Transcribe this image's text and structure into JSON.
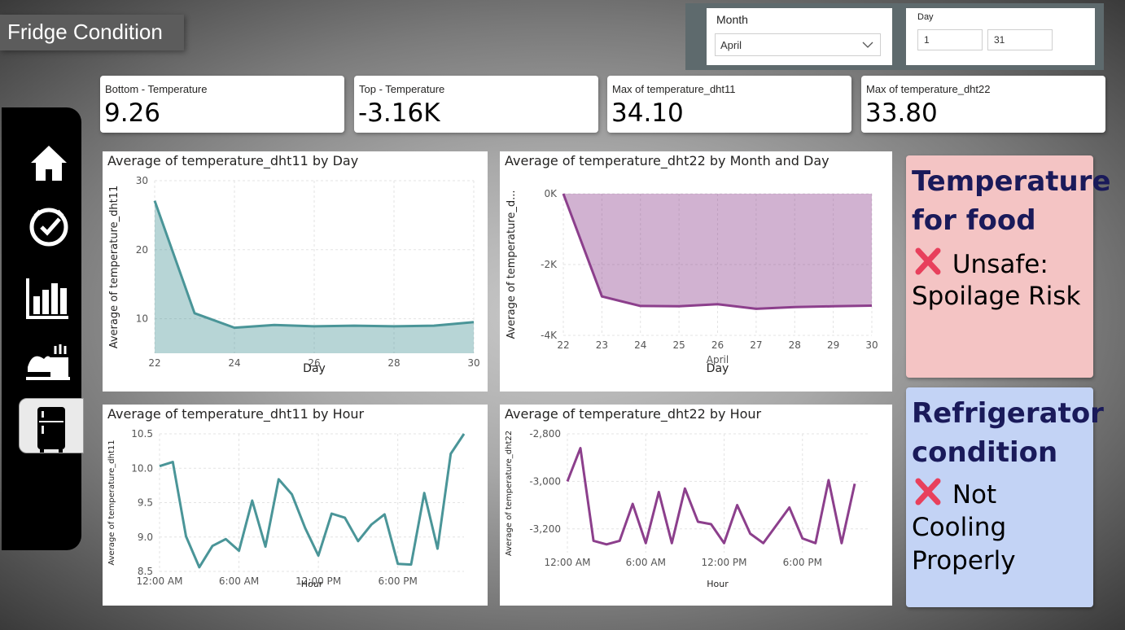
{
  "app_title": "Fridge Condition",
  "filters": {
    "month_label": "Month",
    "month_value": "April",
    "day_label": "Day",
    "day_from": "1",
    "day_to": "31"
  },
  "nav": {
    "items": [
      {
        "icon": "home-icon"
      },
      {
        "icon": "clock-check-icon"
      },
      {
        "icon": "bar-chart-icon"
      },
      {
        "icon": "food-icon"
      },
      {
        "icon": "fridge-icon",
        "active": true
      }
    ]
  },
  "cards": [
    {
      "label": "Bottom - Temperature",
      "value": "9.26"
    },
    {
      "label": "Top - Temperature",
      "value": "-3.16K"
    },
    {
      "label": "Max of temperature_dht11",
      "value": "34.10"
    },
    {
      "label": "Max of temperature_dht22",
      "value": "33.80"
    }
  ],
  "status": {
    "food": {
      "title_line1": "Temperature",
      "title_line2": "for food",
      "line1": "Unsafe:",
      "line2": "Spoilage Risk",
      "color": "#f4c4c4"
    },
    "fridge": {
      "title_line1": "Refrigerator",
      "title_line2": "condition",
      "line1": "Not",
      "line2": "Cooling",
      "line3": "Properly",
      "color": "#c3d3f5"
    }
  },
  "chart_data": [
    {
      "type": "area",
      "title": "Average of temperature_dht11 by Day",
      "xlabel": "Day",
      "ylabel": "Average of temperature_dht11",
      "x": [
        22,
        23,
        24,
        25,
        26,
        27,
        28,
        29,
        30
      ],
      "values": [
        27.1,
        10.8,
        8.7,
        9.1,
        8.9,
        9.0,
        8.9,
        9.0,
        9.5
      ],
      "x_ticks": [
        "22",
        "24",
        "26",
        "28",
        "30"
      ],
      "y_ticks": [
        "30",
        "20",
        "10"
      ],
      "ylim": [
        5,
        30
      ],
      "color": "#4a9598",
      "grid": true
    },
    {
      "type": "area",
      "title": "Average of temperature_dht22 by Month and Day",
      "xlabel": "Day",
      "ylabel": "Average of temperature_d...",
      "x": [
        22,
        23,
        24,
        25,
        26,
        27,
        28,
        29,
        30
      ],
      "values": [
        0,
        -2900,
        -3170,
        -3180,
        -3120,
        -3250,
        -3200,
        -3180,
        -3160
      ],
      "x_ticks": [
        "22",
        "23",
        "24",
        "25",
        "26",
        "27",
        "28",
        "29",
        "30"
      ],
      "x_sub_label": "April",
      "y_ticks": [
        "0K",
        "-2K",
        "-4K"
      ],
      "ylim": [
        -4000,
        0
      ],
      "color": "#8c3f8c",
      "grid": true
    },
    {
      "type": "line",
      "title": "Average of temperature_dht11 by Hour",
      "xlabel": "Hour",
      "ylabel": "Average of temperature_dht11",
      "values": [
        10.03,
        10.09,
        9.01,
        8.56,
        8.87,
        8.97,
        8.8,
        9.53,
        8.86,
        9.84,
        9.62,
        9.13,
        8.73,
        9.34,
        9.28,
        8.94,
        9.18,
        9.33,
        8.61,
        8.6,
        9.64,
        8.83,
        10.21,
        10.5
      ],
      "x_ticks": [
        "12:00 AM",
        "6:00 AM",
        "12:00 PM",
        "6:00 PM"
      ],
      "y_ticks": [
        "10.5",
        "10.0",
        "9.5",
        "9.0",
        "8.5"
      ],
      "ylim": [
        8.5,
        10.5
      ],
      "color": "#4a9598",
      "grid": true
    },
    {
      "type": "line",
      "title": "Average of temperature_dht22 by Hour",
      "xlabel": "Hour",
      "ylabel": "Average of temperature_dht22",
      "values": [
        -3000,
        -2860,
        -3250,
        -3265,
        -3250,
        -3095,
        -3260,
        -3045,
        -3260,
        -3030,
        -3170,
        -3180,
        -3260,
        -3100,
        -3220,
        -3260,
        -3185,
        -3110,
        -3240,
        -3260,
        -2995,
        -3260,
        -3010
      ],
      "x_ticks": [
        "12:00 AM",
        "6:00 AM",
        "12:00 PM",
        "6:00 PM"
      ],
      "y_ticks": [
        "-2,800",
        "-3,000",
        "-3,200"
      ],
      "ylim": [
        -3300,
        -2800
      ],
      "color": "#8c3f8c",
      "grid": true
    }
  ]
}
